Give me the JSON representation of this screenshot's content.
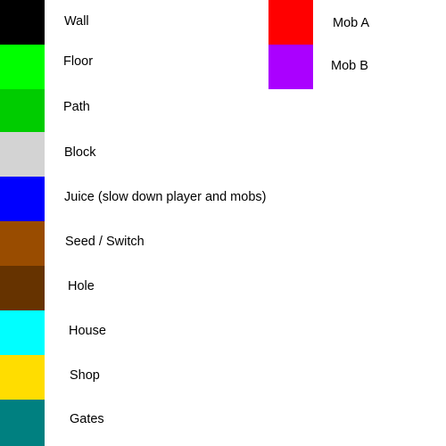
{
  "legend": {
    "left_items": [
      {
        "label": "Wall",
        "color": "#000000"
      },
      {
        "label": "Floor",
        "color": "#00ff00"
      },
      {
        "label": "Path",
        "color": "#00cc00"
      },
      {
        "label": "Block",
        "color": "#d3d3d3"
      },
      {
        "label": "Juice (slow down player and mobs)",
        "color": "#0000ff"
      },
      {
        "label": "Seed / Switch",
        "color": "#994c00"
      },
      {
        "label": "Hole",
        "color": "#663300"
      },
      {
        "label": "House",
        "color": "#00ffff"
      },
      {
        "label": "Shop",
        "color": "#ffdd00"
      },
      {
        "label": "Gates",
        "color": "#008080"
      }
    ],
    "right_items": [
      {
        "label": "Mob A",
        "color": "#ff0000"
      },
      {
        "label": "Mob B",
        "color": "#aa00ff"
      }
    ]
  }
}
